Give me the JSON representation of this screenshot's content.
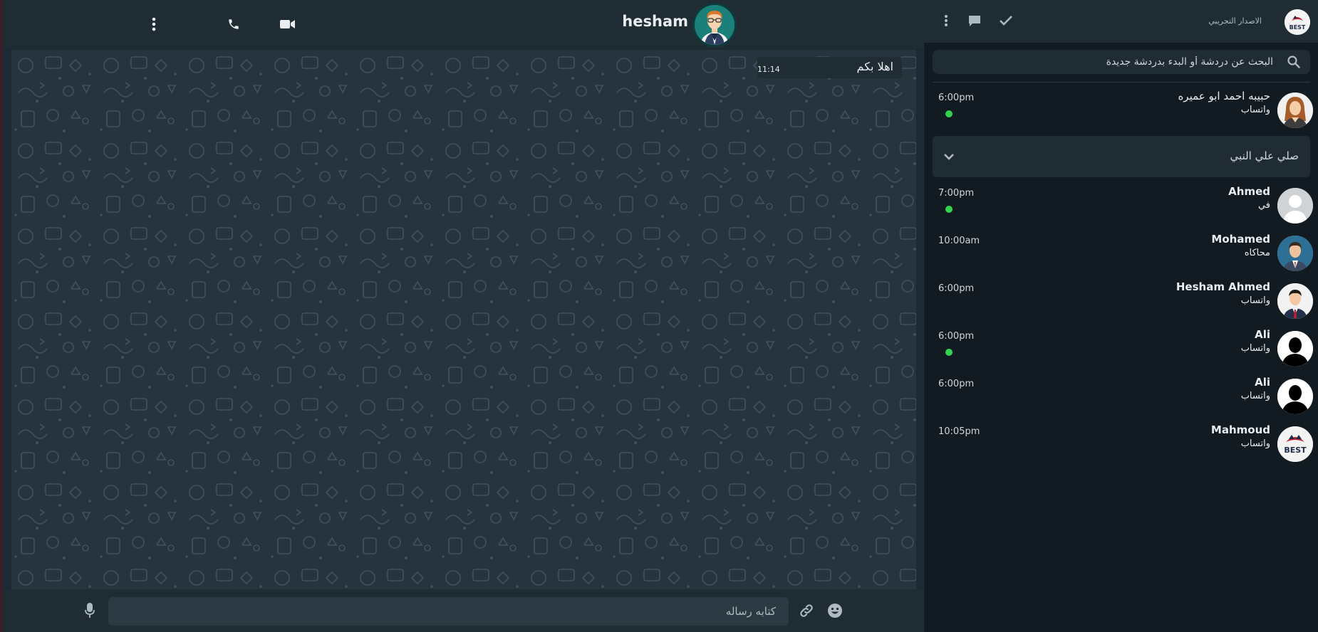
{
  "colors": {
    "accent_online": "#34d34f",
    "panel": "#1f2c34",
    "background": "#111b21",
    "text": "#e9edef"
  },
  "chat": {
    "contact_name": "hesham",
    "header_icons": [
      "more-vertical-icon",
      "phone-icon",
      "video-camera-icon"
    ],
    "messages": [
      {
        "text": "اهلا بكم",
        "time": "11:14"
      }
    ],
    "composer": {
      "placeholder": "كتابه رساله",
      "icons": [
        "microphone-icon",
        "attach-link-icon",
        "emoji-icon"
      ]
    }
  },
  "sidebar": {
    "brand_title": "الاصدار التجريبي",
    "brand_logo_text": "BEST",
    "header_icons": [
      "more-vertical-icon",
      "chat-bubble-icon",
      "check-icon"
    ],
    "search": {
      "placeholder": "البحث عن دردشة أو البدء بدردشة جديدة"
    },
    "group_label": "صلي علي النبي",
    "chats": [
      {
        "name": "حبيبه احمد ابو عميره",
        "sub": "واتساب",
        "time": "6:00pm",
        "online": true,
        "avatar": "woman"
      },
      {
        "name": "Ahmed",
        "sub": "في",
        "time": "7:00pm",
        "online": true,
        "avatar": "default"
      },
      {
        "name": "Mohamed",
        "sub": "محاكاه",
        "time": "10:00am",
        "online": false,
        "avatar": "man-suit"
      },
      {
        "name": "Hesham Ahmed",
        "sub": "واتساب",
        "time": "6:00pm",
        "online": false,
        "avatar": "man-tie"
      },
      {
        "name": "Ali",
        "sub": "واتساب",
        "time": "6:00pm",
        "online": true,
        "avatar": "silhouette"
      },
      {
        "name": "Ali",
        "sub": "واتساب",
        "time": "6:00pm",
        "online": false,
        "avatar": "silhouette"
      },
      {
        "name": "Mahmoud",
        "sub": "واتساب",
        "time": "10:05pm",
        "online": false,
        "avatar": "best-logo"
      }
    ]
  }
}
